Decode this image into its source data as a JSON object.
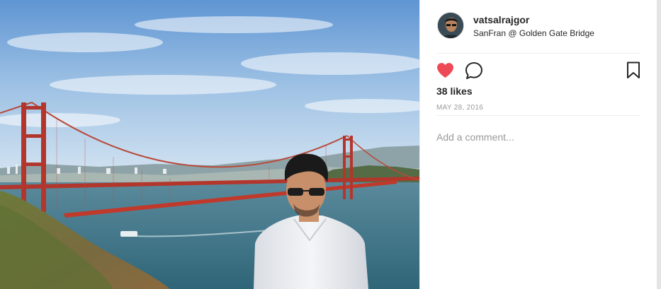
{
  "post": {
    "username": "vatsalrajgor",
    "location": "SanFran @ Golden Gate Bridge",
    "likes": "38 likes",
    "date": "MAY 28, 2016",
    "comment_placeholder": "Add a comment...",
    "liked": true
  },
  "icons": {
    "like": "heart-icon",
    "comment": "comment-bubble-icon",
    "save": "bookmark-icon"
  },
  "colors": {
    "like_red": "#ed4956",
    "text": "#262626",
    "muted": "#999999",
    "bridge": "#c0392b"
  }
}
